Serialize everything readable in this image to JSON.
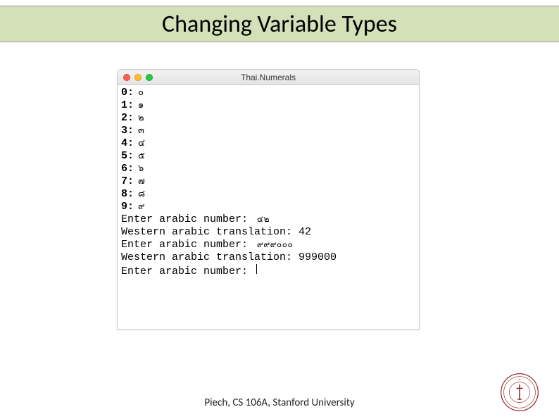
{
  "slide": {
    "title": "Changing Variable Types",
    "footer": "Piech, CS 106A, Stanford University"
  },
  "window": {
    "title": "Thai.Numerals"
  },
  "digit_map": [
    {
      "label": "0:",
      "glyph": "๐"
    },
    {
      "label": "1:",
      "glyph": "๑"
    },
    {
      "label": "2:",
      "glyph": "๒"
    },
    {
      "label": "3:",
      "glyph": "๓"
    },
    {
      "label": "4:",
      "glyph": "๔"
    },
    {
      "label": "5:",
      "glyph": "๕"
    },
    {
      "label": "6:",
      "glyph": "๖"
    },
    {
      "label": "7:",
      "glyph": "๗"
    },
    {
      "label": "8:",
      "glyph": "๘"
    },
    {
      "label": "9:",
      "glyph": "๙"
    }
  ],
  "dialog": {
    "prompt1": "Enter arabic number: ",
    "input1": "๔๒",
    "result1_label": "Western arabic translation: ",
    "result1_value": "42",
    "prompt2": "Enter arabic number: ",
    "input2": "๙๙๙๐๐๐",
    "result2_label": "Western arabic translation: ",
    "result2_value": "999000",
    "prompt3": "Enter arabic number: "
  }
}
